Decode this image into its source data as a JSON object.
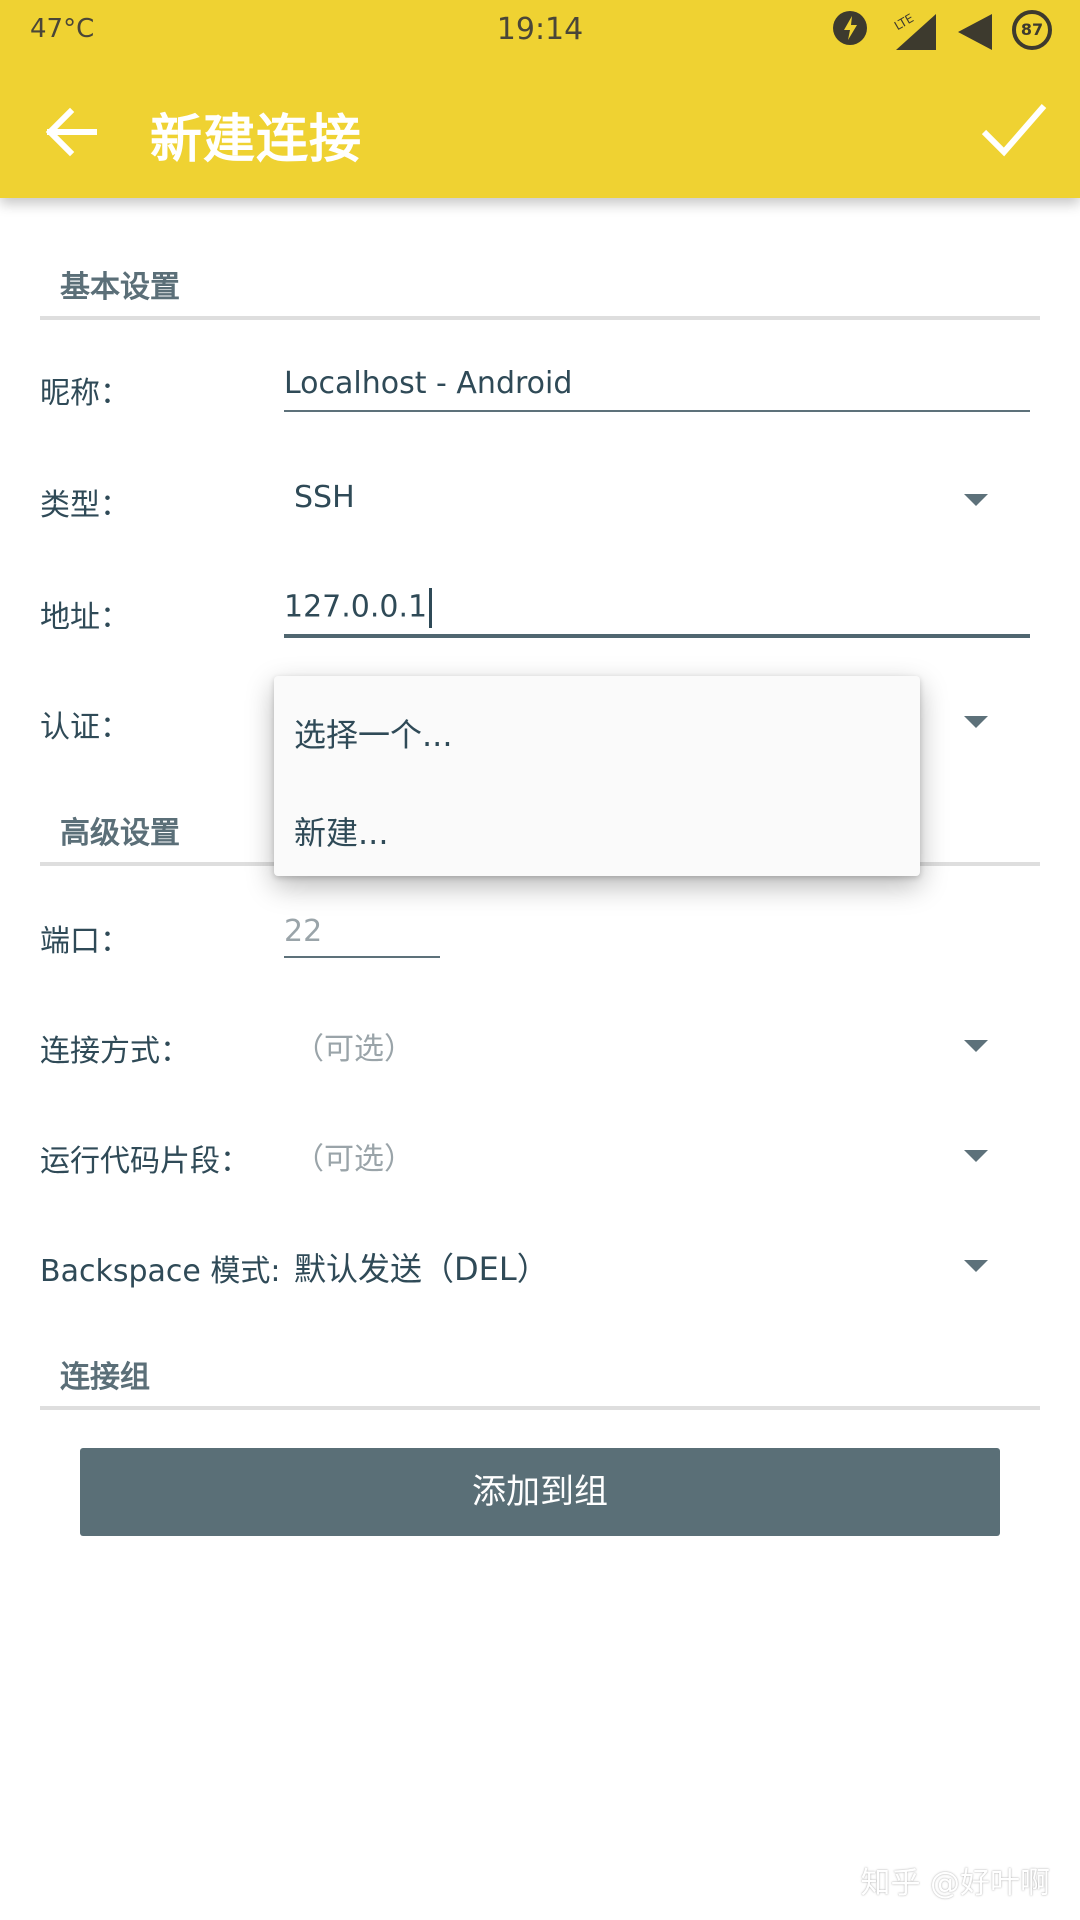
{
  "status_bar": {
    "temperature": "47°C",
    "time": "19:14",
    "lte_label": "LTE",
    "battery": "87"
  },
  "app_bar": {
    "title": "新建连接"
  },
  "basic_section": {
    "title": "基本设置"
  },
  "fields": {
    "nickname": {
      "label": "昵称：",
      "value": "Localhost - Android"
    },
    "type": {
      "label": "类型：",
      "value": "SSH"
    },
    "address": {
      "label": "地址：",
      "value": "127.0.0.1"
    },
    "auth": {
      "label": "认证："
    }
  },
  "auth_menu": {
    "items": [
      "选择一个...",
      "新建..."
    ]
  },
  "advanced_section": {
    "title": "高级设置"
  },
  "advanced_fields": {
    "port": {
      "label": "端口：",
      "placeholder": "22"
    },
    "connect_method": {
      "label": "连接方式：",
      "value": "（可选）"
    },
    "run_snippet": {
      "label": "运行代码片段：",
      "value": "（可选）"
    },
    "backspace_mode": {
      "label": "Backspace 模式:",
      "value": "默认发送（DEL）"
    }
  },
  "group_section": {
    "title": "连接组",
    "add_button": "添加到组"
  },
  "watermark": "知乎 @好叶啊",
  "colors": {
    "app_bar": "#efd232",
    "primary_text": "#2f4a57",
    "button": "#5a6f77"
  }
}
